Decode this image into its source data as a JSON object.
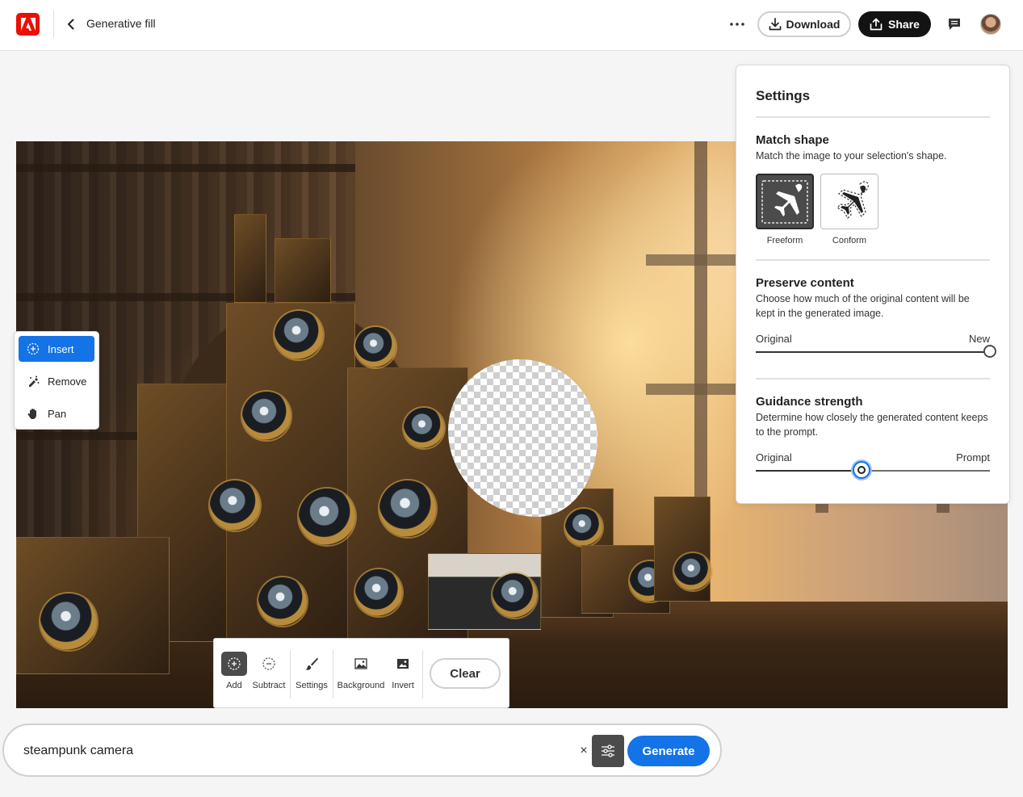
{
  "header": {
    "title": "Generative fill",
    "download_label": "Download",
    "share_label": "Share"
  },
  "tool_menu": {
    "items": [
      {
        "label": "Insert",
        "icon": "insert-icon",
        "active": true
      },
      {
        "label": "Remove",
        "icon": "remove-icon",
        "active": false
      },
      {
        "label": "Pan",
        "icon": "hand-icon",
        "active": false
      }
    ]
  },
  "selection_tools": {
    "add_label": "Add",
    "subtract_label": "Subtract",
    "settings_label": "Settings",
    "background_label": "Background",
    "invert_label": "Invert",
    "clear_label": "Clear"
  },
  "prompt": {
    "value": "steampunk camera",
    "clear_symbol": "×",
    "generate_label": "Generate"
  },
  "settings": {
    "title": "Settings",
    "match_shape": {
      "heading": "Match shape",
      "description": "Match the image to your selection's shape.",
      "options": [
        {
          "label": "Freeform",
          "selected": true
        },
        {
          "label": "Conform",
          "selected": false
        }
      ]
    },
    "preserve_content": {
      "heading": "Preserve content",
      "description": "Choose how much of the original content will be kept in the generated image.",
      "min_label": "Original",
      "max_label": "New",
      "value": 1.0
    },
    "guidance_strength": {
      "heading": "Guidance strength",
      "description": "Determine how closely the generated content keeps to the prompt.",
      "min_label": "Original",
      "max_label": "Prompt",
      "value": 0.45
    }
  },
  "colors": {
    "accent": "#1473e6",
    "logo": "#eb1000",
    "dark_button": "#131313"
  }
}
